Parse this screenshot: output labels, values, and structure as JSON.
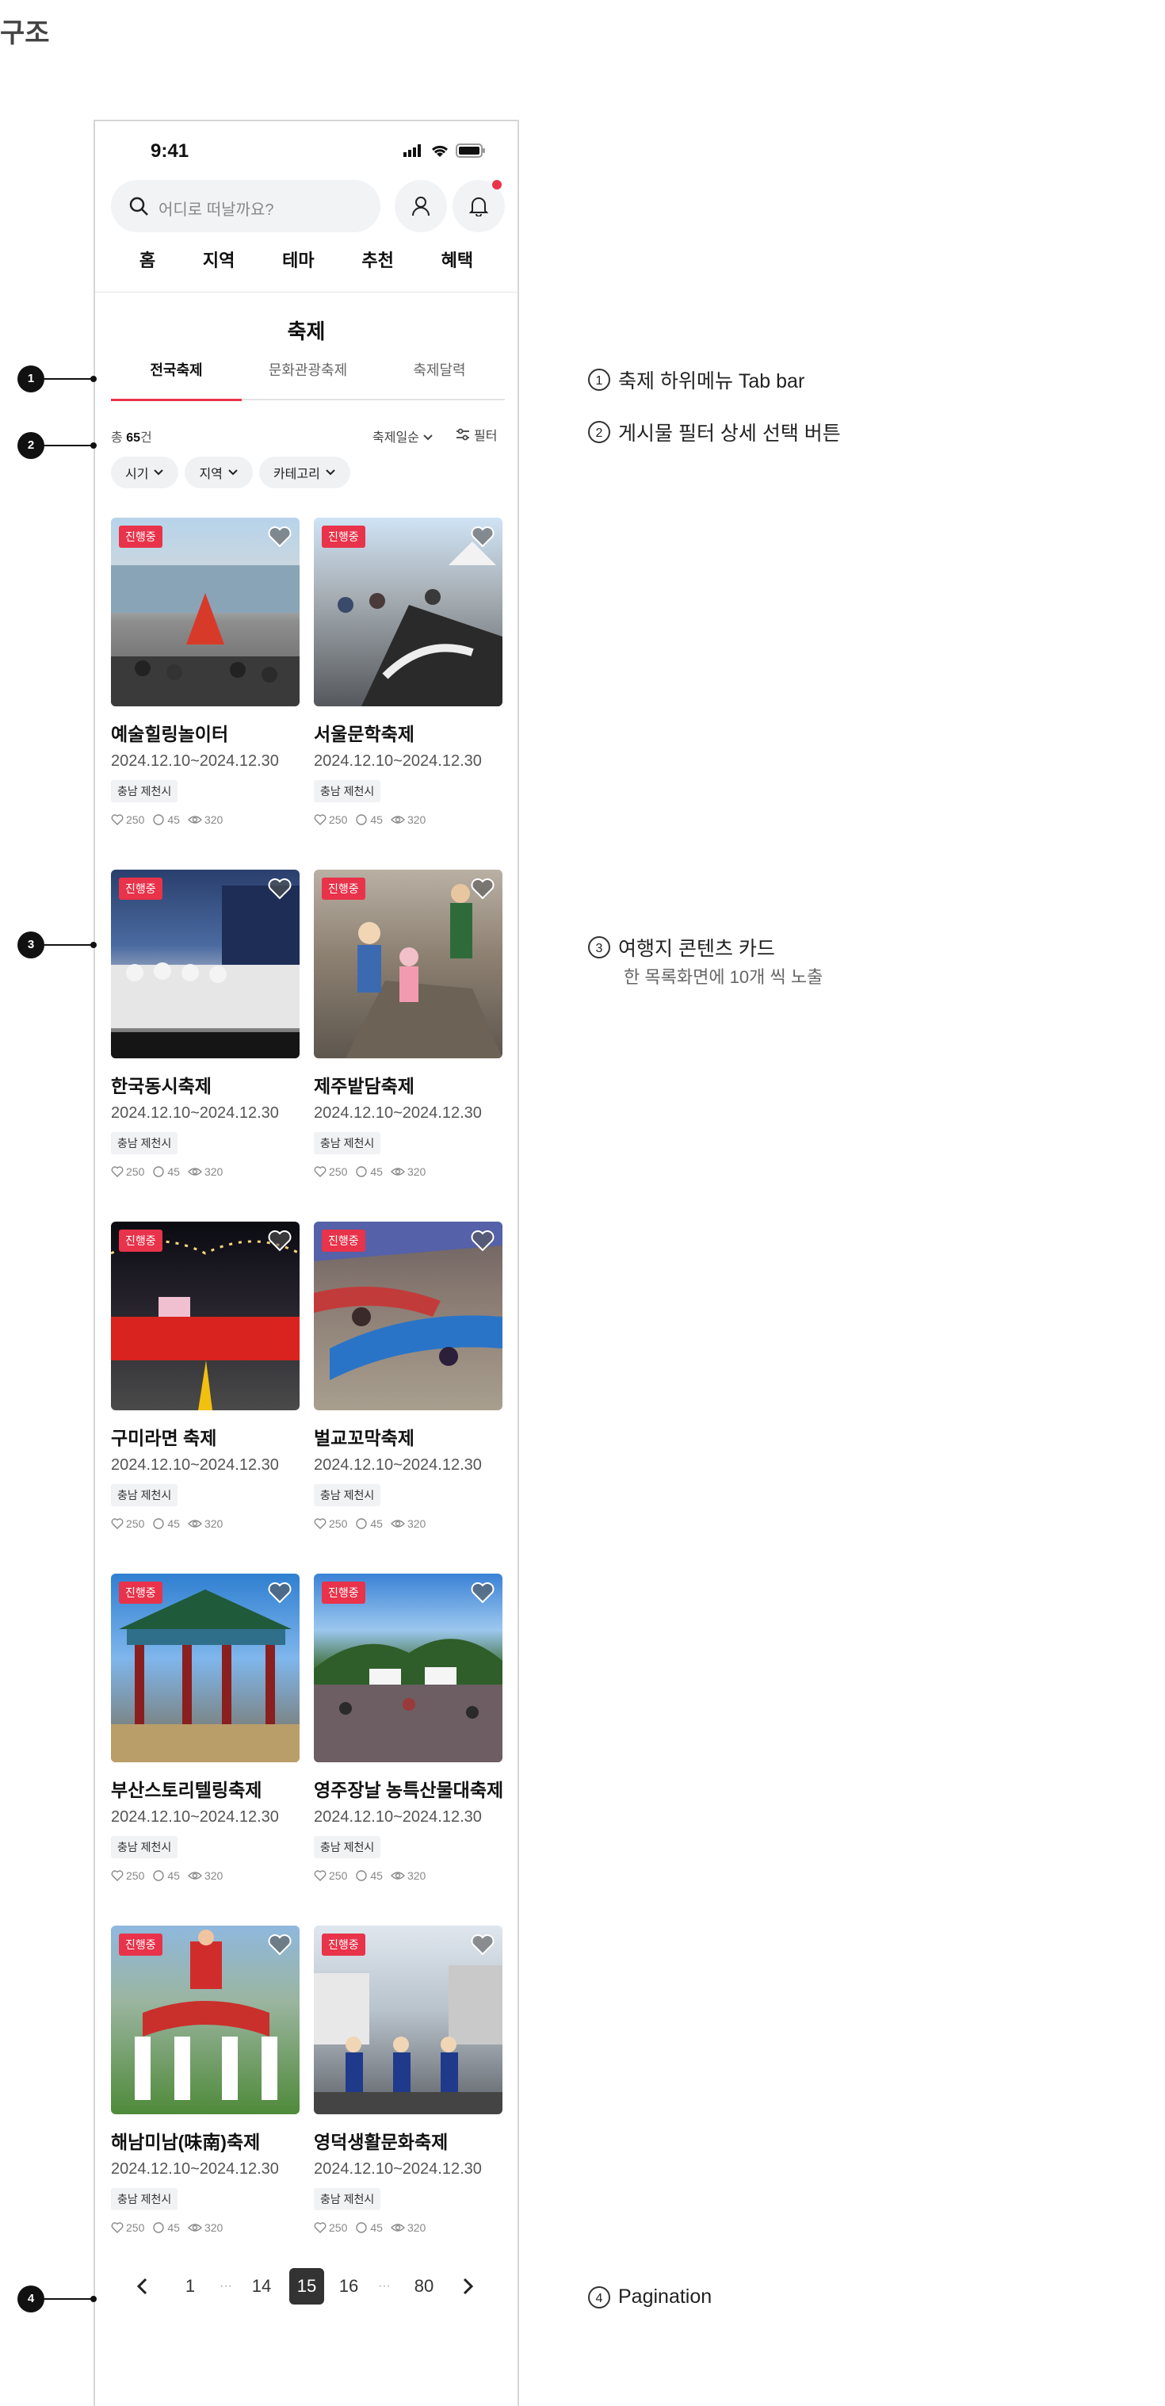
{
  "page_heading": "구조",
  "status": {
    "time": "9:41"
  },
  "search": {
    "placeholder": "어디로 떠날까요?"
  },
  "main_nav": [
    "홈",
    "지역",
    "테마",
    "추천",
    "혜택"
  ],
  "section_title": "축제",
  "tabs": [
    {
      "label": "전국축제",
      "active": true
    },
    {
      "label": "문화관광축제",
      "active": false
    },
    {
      "label": "축제달력",
      "active": false
    }
  ],
  "listing": {
    "total_prefix": "총",
    "total_count": "65",
    "total_suffix": "건",
    "sort_label": "축제일순",
    "filter_label": "필터"
  },
  "chips": [
    "시기",
    "지역",
    "카테고리"
  ],
  "cards": [
    {
      "badge": "진행중",
      "title": "예술힐링놀이터",
      "date": "2024.12.10~2024.12.30",
      "tag": "충남 제천시",
      "likes": "250",
      "comments": "45",
      "views": "320"
    },
    {
      "badge": "진행중",
      "title": "서울문학축제",
      "date": "2024.12.10~2024.12.30",
      "tag": "충남 제천시",
      "likes": "250",
      "comments": "45",
      "views": "320"
    },
    {
      "badge": "진행중",
      "title": "한국동시축제",
      "date": "2024.12.10~2024.12.30",
      "tag": "충남 제천시",
      "likes": "250",
      "comments": "45",
      "views": "320"
    },
    {
      "badge": "진행중",
      "title": "제주밭담축제",
      "date": "2024.12.10~2024.12.30",
      "tag": "충남 제천시",
      "likes": "250",
      "comments": "45",
      "views": "320"
    },
    {
      "badge": "진행중",
      "title": "구미라면 축제",
      "date": "2024.12.10~2024.12.30",
      "tag": "충남 제천시",
      "likes": "250",
      "comments": "45",
      "views": "320"
    },
    {
      "badge": "진행중",
      "title": "벌교꼬막축제",
      "date": "2024.12.10~2024.12.30",
      "tag": "충남 제천시",
      "likes": "250",
      "comments": "45",
      "views": "320"
    },
    {
      "badge": "진행중",
      "title": "부산스토리텔링축제",
      "date": "2024.12.10~2024.12.30",
      "tag": "충남 제천시",
      "likes": "250",
      "comments": "45",
      "views": "320"
    },
    {
      "badge": "진행중",
      "title": "영주장날 농특산물대축제",
      "date": "2024.12.10~2024.12.30",
      "tag": "충남 제천시",
      "likes": "250",
      "comments": "45",
      "views": "320"
    },
    {
      "badge": "진행중",
      "title": "해남미남(味南)축제",
      "date": "2024.12.10~2024.12.30",
      "tag": "충남 제천시",
      "likes": "250",
      "comments": "45",
      "views": "320"
    },
    {
      "badge": "진행중",
      "title": "영덕생활문화축제",
      "date": "2024.12.10~2024.12.30",
      "tag": "충남 제천시",
      "likes": "250",
      "comments": "45",
      "views": "320"
    }
  ],
  "pagination": {
    "pages": [
      "1",
      "···",
      "14",
      "15",
      "16",
      "···",
      "80"
    ],
    "current": "15"
  },
  "annotations": [
    {
      "num": "1",
      "text": "축제 하위메뉴 Tab bar"
    },
    {
      "num": "2",
      "text": "게시물 필터 상세 선택 버튼"
    },
    {
      "num": "3",
      "text": "여행지 콘텐츠 카드",
      "sub": "한 목록화면에 10개 씩 노출"
    },
    {
      "num": "4",
      "text": "Pagination"
    }
  ],
  "colors": {
    "accent": "#e8334a",
    "pagination_current": "#333333"
  }
}
